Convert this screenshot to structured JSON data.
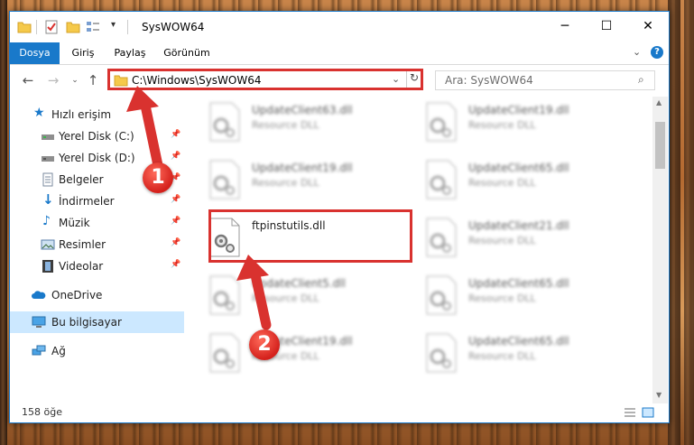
{
  "window": {
    "title": "SysWOW64",
    "minimize": "─",
    "maximize": "☐",
    "close": "✕"
  },
  "ribbon": {
    "tabs": [
      "Dosya",
      "Giriş",
      "Paylaş",
      "Görünüm"
    ],
    "help": "?"
  },
  "address": {
    "path": "C:\\Windows\\SysWOW64",
    "search_placeholder": "Ara: SysWOW64"
  },
  "sidebar": {
    "items": [
      {
        "label": "Hızlı erişim",
        "icon": "star-icon"
      },
      {
        "label": "Yerel Disk (C:)",
        "icon": "drive-icon",
        "pinned": true
      },
      {
        "label": "Yerel Disk (D:)",
        "icon": "drive-icon",
        "pinned": true
      },
      {
        "label": "Belgeler",
        "icon": "documents-icon",
        "pinned": true
      },
      {
        "label": "İndirmeler",
        "icon": "download-icon",
        "pinned": true
      },
      {
        "label": "Müzik",
        "icon": "music-icon",
        "pinned": true
      },
      {
        "label": "Resimler",
        "icon": "pictures-icon",
        "pinned": true
      },
      {
        "label": "Videolar",
        "icon": "videos-icon",
        "pinned": true
      },
      {
        "label": "OneDrive",
        "icon": "cloud-icon"
      },
      {
        "label": "Bu bilgisayar",
        "icon": "computer-icon",
        "selected": true
      },
      {
        "label": "Ağ",
        "icon": "network-icon"
      }
    ]
  },
  "files": {
    "col1": [
      {
        "name": "UpdateClient63.dll",
        "type": "Resource DLL"
      },
      {
        "name": "UpdateClient19.dll",
        "type": "Resource DLL"
      },
      {
        "name": "ftpinstutils.dll",
        "type": ""
      },
      {
        "name": "UpdateClient5.dll",
        "type": "Resource DLL"
      },
      {
        "name": "UpdateClient19.dll",
        "type": "Resource DLL"
      }
    ],
    "col2": [
      {
        "name": "UpdateClient19.dll",
        "type": "Resource DLL"
      },
      {
        "name": "UpdateClient65.dll",
        "type": "Resource DLL"
      },
      {
        "name": "UpdateClient21.dll",
        "type": "Resource DLL"
      },
      {
        "name": "UpdateClient65.dll",
        "type": "Resource DLL"
      },
      {
        "name": "UpdateClient65.dll",
        "type": "Resource DLL"
      }
    ]
  },
  "status": {
    "count": "158 öğe"
  },
  "annotations": {
    "step1": "1",
    "step2": "2"
  },
  "colors": {
    "accent": "#1979ca",
    "highlight": "#d9322f",
    "selected": "#cce8ff"
  }
}
